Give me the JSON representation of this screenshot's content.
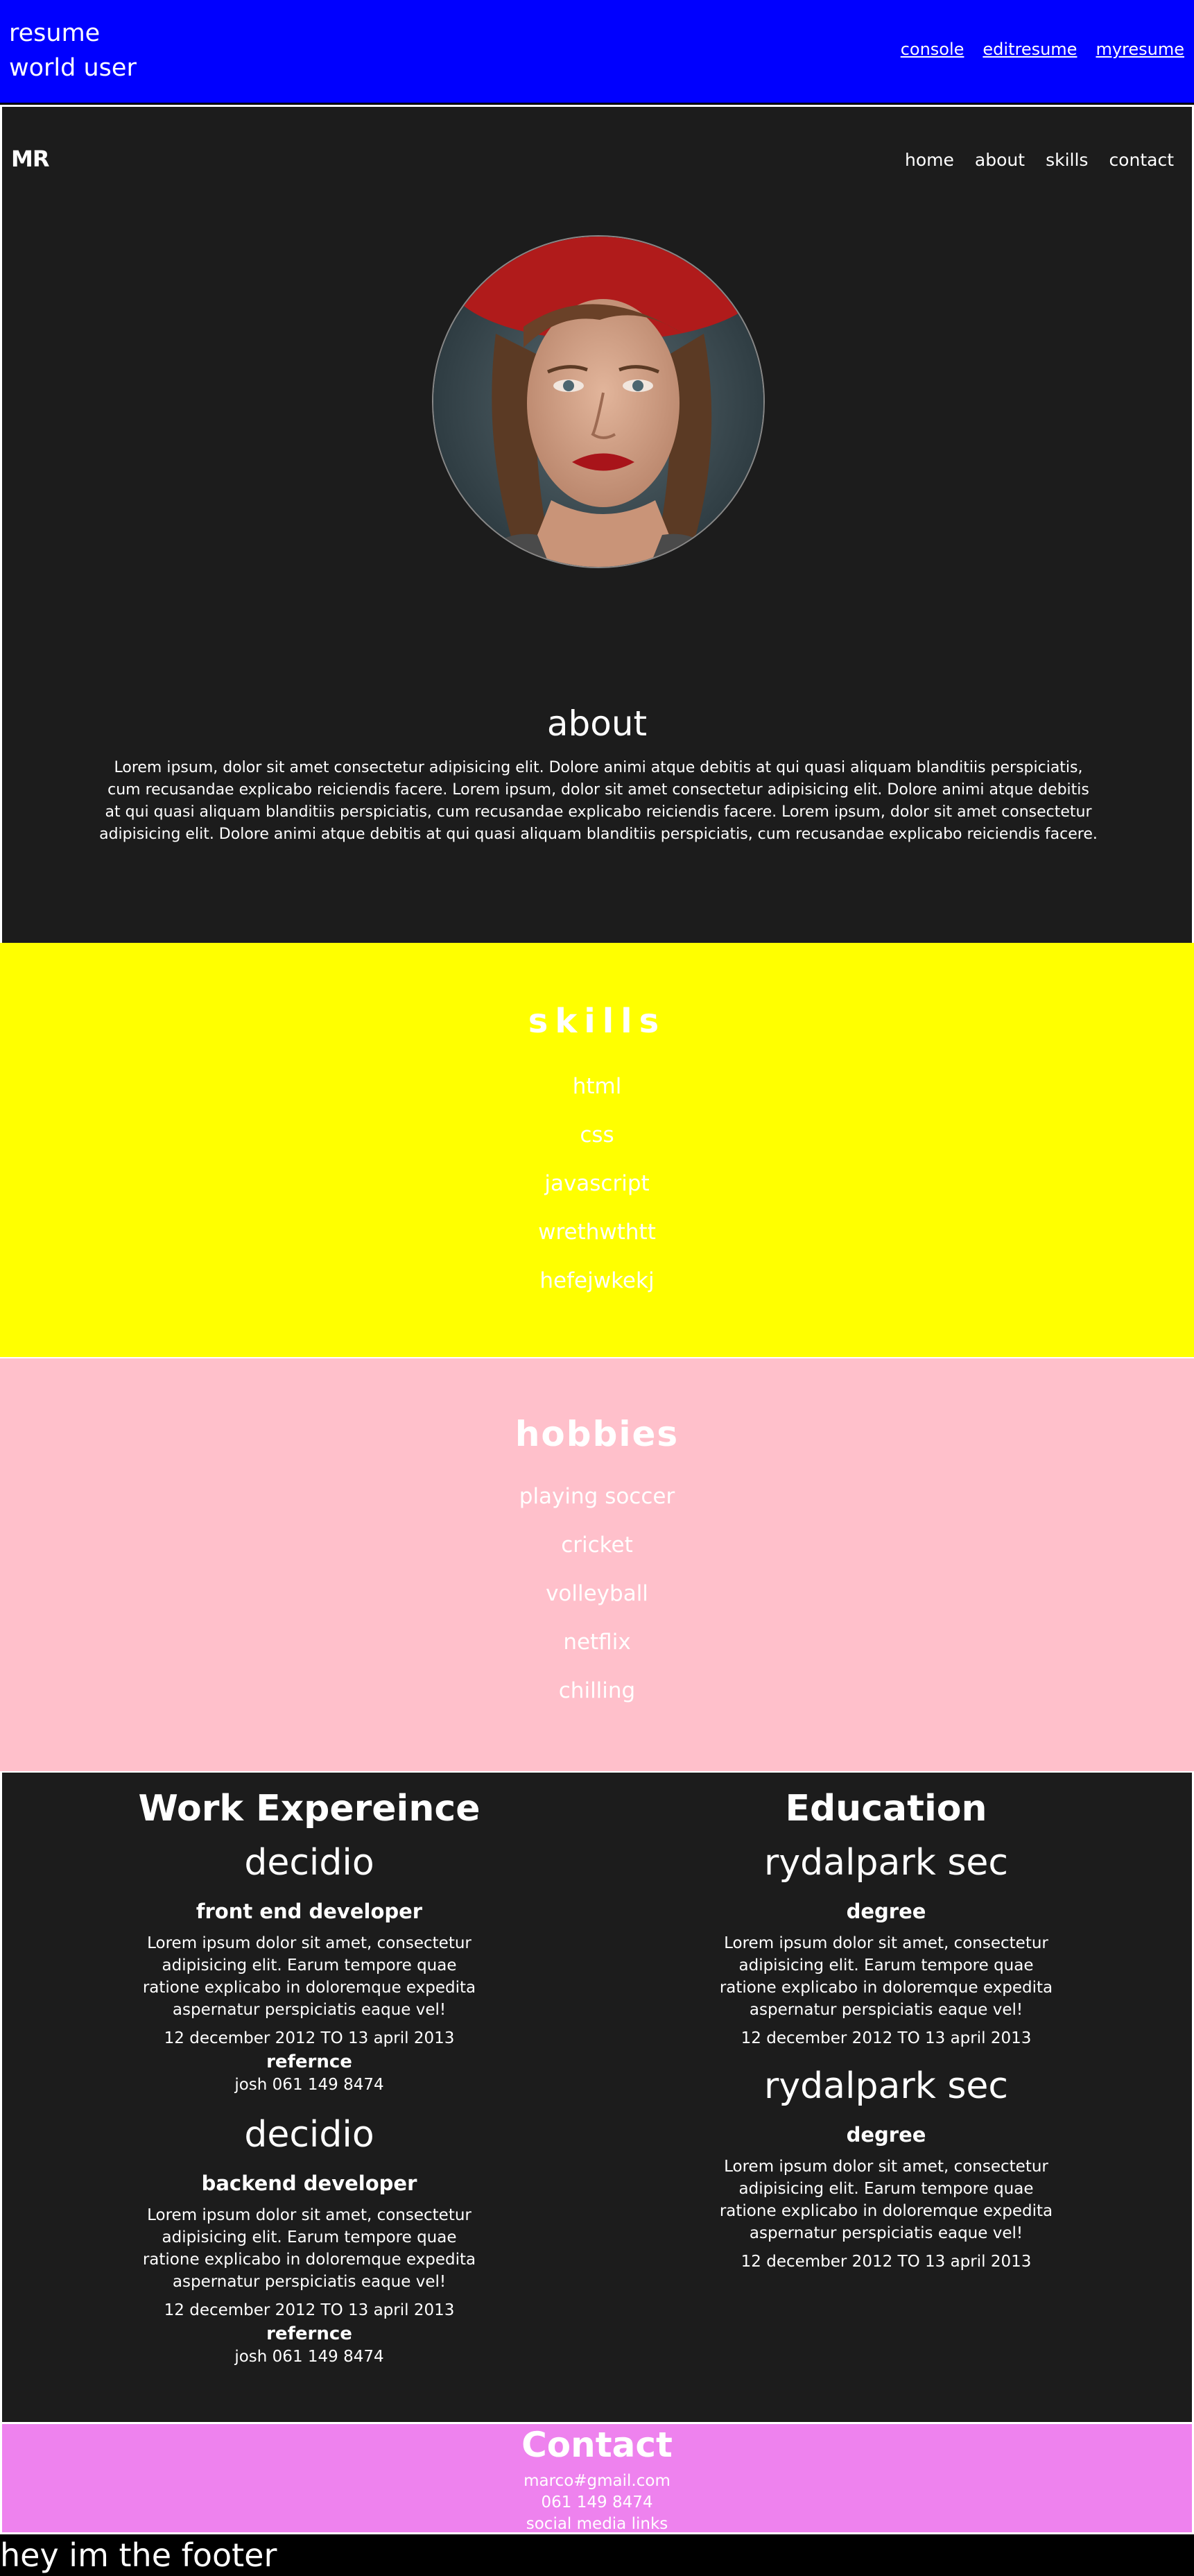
{
  "topbar": {
    "brand_line1": "resume",
    "brand_line2": "world user",
    "links": [
      "console",
      "editresume",
      "myresume"
    ]
  },
  "profile": {
    "logo": "MR",
    "nav": [
      "home",
      "about",
      "skills",
      "contact"
    ],
    "avatar_alt": "portrait photo",
    "about_title": "about",
    "about_text": "Lorem ipsum, dolor sit amet consectetur adipisicing elit. Dolore animi atque debitis at qui quasi aliquam blanditiis perspiciatis, cum recusandae explicabo reiciendis facere. Lorem ipsum, dolor sit amet consectetur adipisicing elit. Dolore animi atque debitis at qui quasi aliquam blanditiis perspiciatis, cum recusandae explicabo reiciendis facere. Lorem ipsum, dolor sit amet consectetur adipisicing elit. Dolore animi atque debitis at qui quasi aliquam blanditiis perspiciatis, cum recusandae explicabo reiciendis facere."
  },
  "skills": {
    "title": "skills",
    "items": [
      "html",
      "css",
      "javascript",
      "wrethwthtt",
      "hefejwkekj"
    ]
  },
  "hobbies": {
    "title": "hobbies",
    "items": [
      "playing soccer",
      "cricket",
      "volleyball",
      "netflix",
      "chilling"
    ]
  },
  "work": {
    "title": "Work Expereince",
    "entries": [
      {
        "org": "decidio",
        "role": "front end developer",
        "desc": "Lorem ipsum dolor sit amet, consectetur adipisicing elit. Earum tempore quae ratione explicabo in doloremque expedita aspernatur perspiciatis eaque vel!",
        "dates": "12 december 2012 TO 13 april 2013",
        "ref_title": "refernce",
        "ref": "josh 061 149 8474"
      },
      {
        "org": "decidio",
        "role": "backend developer",
        "desc": "Lorem ipsum dolor sit amet, consectetur adipisicing elit. Earum tempore quae ratione explicabo in doloremque expedita aspernatur perspiciatis eaque vel!",
        "dates": "12 december 2012 TO 13 april 2013",
        "ref_title": "refernce",
        "ref": "josh 061 149 8474"
      }
    ]
  },
  "education": {
    "title": "Education",
    "entries": [
      {
        "org": "rydalpark sec",
        "role": "degree",
        "desc": "Lorem ipsum dolor sit amet, consectetur adipisicing elit. Earum tempore quae ratione explicabo in doloremque expedita aspernatur perspiciatis eaque vel!",
        "dates": "12 december 2012 TO 13 april 2013"
      },
      {
        "org": "rydalpark sec",
        "role": "degree",
        "desc": "Lorem ipsum dolor sit amet, consectetur adipisicing elit. Earum tempore quae ratione explicabo in doloremque expedita aspernatur perspiciatis eaque vel!",
        "dates": "12 december 2012 TO 13 april 2013"
      }
    ]
  },
  "contact": {
    "title": "Contact",
    "email": "marco#gmail.com",
    "phone": "061 149 8474",
    "social": "social media links"
  },
  "footer": {
    "text": "hey im the footer"
  },
  "colors": {
    "topbar": "#0000ff",
    "dark": "#1c1c1c",
    "skills": "#ffff00",
    "hobbies": "#ffc0cb",
    "contact": "#ee82ee"
  }
}
